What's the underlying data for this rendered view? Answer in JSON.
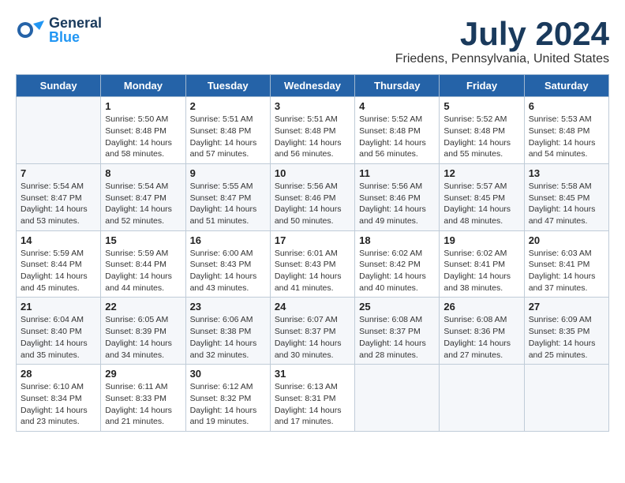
{
  "header": {
    "logo": {
      "general": "General",
      "blue": "Blue"
    },
    "title": "July 2024",
    "location": "Friedens, Pennsylvania, United States"
  },
  "days_of_week": [
    "Sunday",
    "Monday",
    "Tuesday",
    "Wednesday",
    "Thursday",
    "Friday",
    "Saturday"
  ],
  "weeks": [
    [
      {
        "day": "",
        "info": ""
      },
      {
        "day": "1",
        "info": "Sunrise: 5:50 AM\nSunset: 8:48 PM\nDaylight: 14 hours\nand 58 minutes."
      },
      {
        "day": "2",
        "info": "Sunrise: 5:51 AM\nSunset: 8:48 PM\nDaylight: 14 hours\nand 57 minutes."
      },
      {
        "day": "3",
        "info": "Sunrise: 5:51 AM\nSunset: 8:48 PM\nDaylight: 14 hours\nand 56 minutes."
      },
      {
        "day": "4",
        "info": "Sunrise: 5:52 AM\nSunset: 8:48 PM\nDaylight: 14 hours\nand 56 minutes."
      },
      {
        "day": "5",
        "info": "Sunrise: 5:52 AM\nSunset: 8:48 PM\nDaylight: 14 hours\nand 55 minutes."
      },
      {
        "day": "6",
        "info": "Sunrise: 5:53 AM\nSunset: 8:48 PM\nDaylight: 14 hours\nand 54 minutes."
      }
    ],
    [
      {
        "day": "7",
        "info": "Sunrise: 5:54 AM\nSunset: 8:47 PM\nDaylight: 14 hours\nand 53 minutes."
      },
      {
        "day": "8",
        "info": "Sunrise: 5:54 AM\nSunset: 8:47 PM\nDaylight: 14 hours\nand 52 minutes."
      },
      {
        "day": "9",
        "info": "Sunrise: 5:55 AM\nSunset: 8:47 PM\nDaylight: 14 hours\nand 51 minutes."
      },
      {
        "day": "10",
        "info": "Sunrise: 5:56 AM\nSunset: 8:46 PM\nDaylight: 14 hours\nand 50 minutes."
      },
      {
        "day": "11",
        "info": "Sunrise: 5:56 AM\nSunset: 8:46 PM\nDaylight: 14 hours\nand 49 minutes."
      },
      {
        "day": "12",
        "info": "Sunrise: 5:57 AM\nSunset: 8:45 PM\nDaylight: 14 hours\nand 48 minutes."
      },
      {
        "day": "13",
        "info": "Sunrise: 5:58 AM\nSunset: 8:45 PM\nDaylight: 14 hours\nand 47 minutes."
      }
    ],
    [
      {
        "day": "14",
        "info": "Sunrise: 5:59 AM\nSunset: 8:44 PM\nDaylight: 14 hours\nand 45 minutes."
      },
      {
        "day": "15",
        "info": "Sunrise: 5:59 AM\nSunset: 8:44 PM\nDaylight: 14 hours\nand 44 minutes."
      },
      {
        "day": "16",
        "info": "Sunrise: 6:00 AM\nSunset: 8:43 PM\nDaylight: 14 hours\nand 43 minutes."
      },
      {
        "day": "17",
        "info": "Sunrise: 6:01 AM\nSunset: 8:43 PM\nDaylight: 14 hours\nand 41 minutes."
      },
      {
        "day": "18",
        "info": "Sunrise: 6:02 AM\nSunset: 8:42 PM\nDaylight: 14 hours\nand 40 minutes."
      },
      {
        "day": "19",
        "info": "Sunrise: 6:02 AM\nSunset: 8:41 PM\nDaylight: 14 hours\nand 38 minutes."
      },
      {
        "day": "20",
        "info": "Sunrise: 6:03 AM\nSunset: 8:41 PM\nDaylight: 14 hours\nand 37 minutes."
      }
    ],
    [
      {
        "day": "21",
        "info": "Sunrise: 6:04 AM\nSunset: 8:40 PM\nDaylight: 14 hours\nand 35 minutes."
      },
      {
        "day": "22",
        "info": "Sunrise: 6:05 AM\nSunset: 8:39 PM\nDaylight: 14 hours\nand 34 minutes."
      },
      {
        "day": "23",
        "info": "Sunrise: 6:06 AM\nSunset: 8:38 PM\nDaylight: 14 hours\nand 32 minutes."
      },
      {
        "day": "24",
        "info": "Sunrise: 6:07 AM\nSunset: 8:37 PM\nDaylight: 14 hours\nand 30 minutes."
      },
      {
        "day": "25",
        "info": "Sunrise: 6:08 AM\nSunset: 8:37 PM\nDaylight: 14 hours\nand 28 minutes."
      },
      {
        "day": "26",
        "info": "Sunrise: 6:08 AM\nSunset: 8:36 PM\nDaylight: 14 hours\nand 27 minutes."
      },
      {
        "day": "27",
        "info": "Sunrise: 6:09 AM\nSunset: 8:35 PM\nDaylight: 14 hours\nand 25 minutes."
      }
    ],
    [
      {
        "day": "28",
        "info": "Sunrise: 6:10 AM\nSunset: 8:34 PM\nDaylight: 14 hours\nand 23 minutes."
      },
      {
        "day": "29",
        "info": "Sunrise: 6:11 AM\nSunset: 8:33 PM\nDaylight: 14 hours\nand 21 minutes."
      },
      {
        "day": "30",
        "info": "Sunrise: 6:12 AM\nSunset: 8:32 PM\nDaylight: 14 hours\nand 19 minutes."
      },
      {
        "day": "31",
        "info": "Sunrise: 6:13 AM\nSunset: 8:31 PM\nDaylight: 14 hours\nand 17 minutes."
      },
      {
        "day": "",
        "info": ""
      },
      {
        "day": "",
        "info": ""
      },
      {
        "day": "",
        "info": ""
      }
    ]
  ]
}
